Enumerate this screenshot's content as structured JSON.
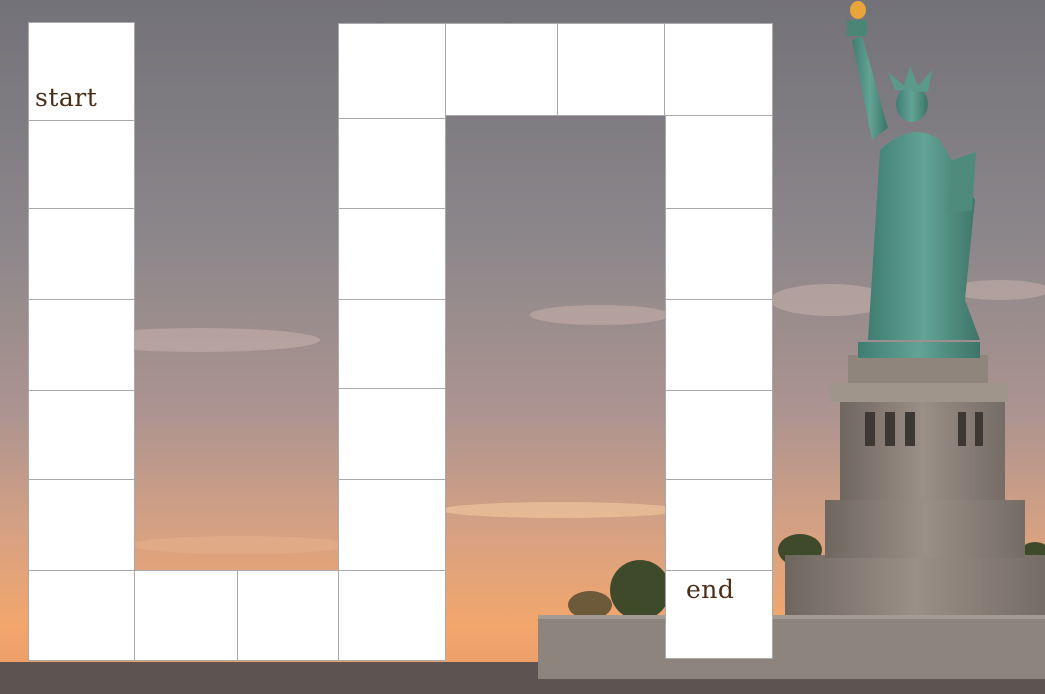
{
  "board": {
    "start_label": "start",
    "end_label": "end"
  },
  "background": {
    "sky_top": "#7d7c82",
    "sky_mid": "#a99492",
    "sunset_glow": "#f0a068",
    "statue_copper": "#4f8f80",
    "pedestal_stone": "#8a7f78"
  }
}
